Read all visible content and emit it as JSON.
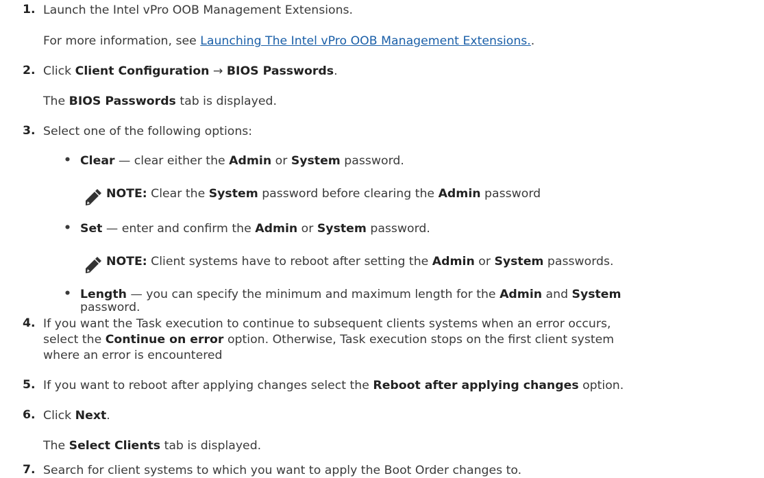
{
  "steps": [
    {
      "num": "1.",
      "text": "Launch the Intel vPro OOB Management Extensions."
    },
    {
      "more_info": "For more information, see ",
      "link": "Launching The Intel vPro OOB Management Extensions.",
      "after": "."
    },
    {
      "num": "2.",
      "a": "Click ",
      "b1": "Client Configuration",
      "arrow": " → ",
      "b2": "BIOS Passwords",
      "end": "."
    },
    {
      "pre": "The ",
      "b": "BIOS Passwords",
      "post": " tab is displayed."
    },
    {
      "num": "3.",
      "text": "Select one of the following options:"
    }
  ],
  "bullets": {
    "clear": {
      "label": "Clear",
      "a": " — clear either the ",
      "admin": "Admin",
      "or": " or ",
      "system": "System",
      "end": " password."
    },
    "note1": {
      "label": "NOTE:",
      "a": " Clear the ",
      "system": "System",
      "b": " password before clearing the ",
      "admin": "Admin",
      "c": " password"
    },
    "set": {
      "label": "Set",
      "a": " — enter and confirm the ",
      "admin": "Admin",
      "or": " or ",
      "system": "System",
      "end": " password."
    },
    "note2": {
      "label": "NOTE:",
      "a": " Client systems have to reboot after setting the ",
      "admin": "Admin",
      "or": " or ",
      "system": "System",
      "end": " passwords."
    },
    "length": {
      "label": "Length",
      "a": " — you can specify the minimum and maximum length for the ",
      "admin": "Admin",
      "and": " and ",
      "system": "System",
      "line2": "password."
    }
  },
  "step4": {
    "num": "4.",
    "l1": "If you want the Task execution to continue to subsequent clients systems when an error occurs,",
    "l2a": "select the ",
    "l2b": "Continue on error",
    "l2c": " option. Otherwise, Task execution stops on the first client system",
    "l3": "where an error is encountered"
  },
  "step5": {
    "num": "5.",
    "a": "If you want to reboot after applying changes select the ",
    "b": "Reboot after applying changes",
    "c": " option."
  },
  "step6": {
    "num": "6.",
    "a": "Click ",
    "b": "Next",
    "c": ".",
    "r_pre": "The ",
    "r_b": "Select Clients",
    "r_post": " tab is displayed."
  },
  "step7": {
    "num": "7.",
    "text": "Search for client systems to which you want to apply the Boot Order changes to."
  },
  "icons": {
    "note": "pencil-note-icon",
    "bullet": "•"
  }
}
